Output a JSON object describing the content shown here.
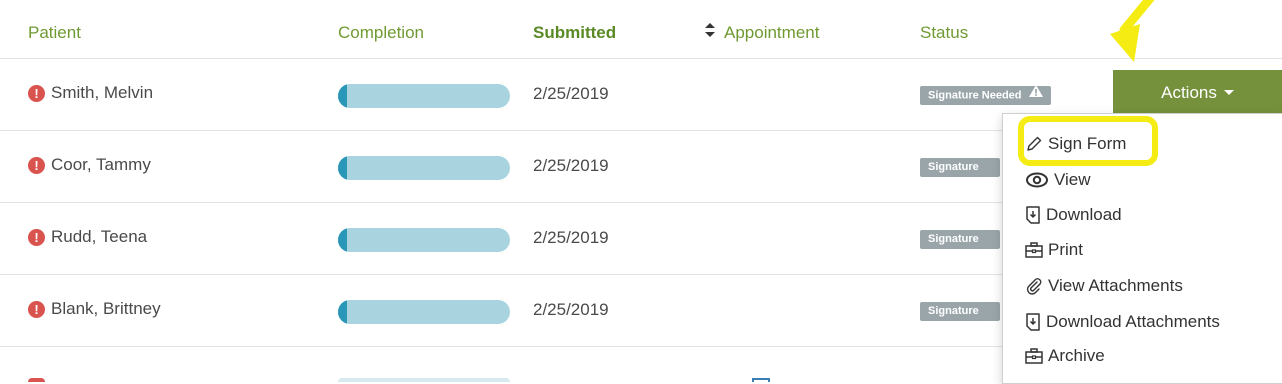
{
  "columns": {
    "patient": "Patient",
    "completion": "Completion",
    "submitted": "Submitted",
    "appointment": "Appointment",
    "status": "Status"
  },
  "rows": [
    {
      "patient": "Smith, Melvin",
      "completion": 0.05,
      "submitted": "2/25/2019",
      "status": "Signature Needed"
    },
    {
      "patient": "Coor, Tammy",
      "completion": 0.05,
      "submitted": "2/25/2019",
      "status": "Signature"
    },
    {
      "patient": "Rudd, Teena",
      "completion": 0.05,
      "submitted": "2/25/2019",
      "status": "Signature"
    },
    {
      "patient": "Blank, Brittney",
      "completion": 0.05,
      "submitted": "2/25/2019",
      "status": "Signature"
    }
  ],
  "actions": {
    "label": "Actions",
    "menu": [
      "Sign Form",
      "View",
      "Download",
      "Print",
      "View Attachments",
      "Download Attachments",
      "Archive"
    ]
  },
  "colors": {
    "header_text": "#6f9a32",
    "action_button": "#76913c",
    "alert": "#d9534f",
    "badge": "#9aa5aa",
    "progress_track": "#a9d3de",
    "progress_fill": "#2b97b8",
    "annotation": "#f5ec14"
  },
  "icons": {
    "alert": "exclamation-circle-icon",
    "sort": "sort-icon",
    "warning": "warning-triangle-icon",
    "sign": "pencil-icon",
    "view": "eye-icon",
    "download": "download-file-icon",
    "print": "printer-icon",
    "attachments": "paperclip-icon",
    "archive": "archive-box-icon"
  }
}
